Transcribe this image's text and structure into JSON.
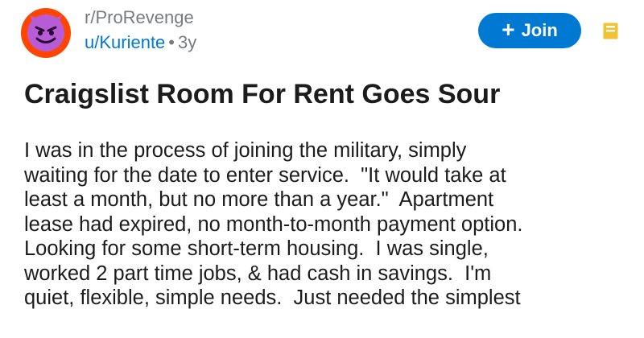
{
  "post": {
    "subreddit": "r/ProRevenge",
    "author": "u/Kuriente",
    "separator": "•",
    "age": "3y",
    "join_label": "Join",
    "join_icon": "+",
    "title": "Craigslist Room For Rent Goes Sour",
    "body_lines": [
      "I was in the process of joining the military, simply",
      "waiting for the date to enter service.  \"It would take at",
      "least a month, but no more than a year.\"  Apartment",
      "lease had expired, no month-to-month payment option.",
      "Looking for some short-term housing.  I was single,",
      "worked 2 part time jobs, & had cash in savings.  I'm",
      "quiet, flexible, simple needs.  Just needed the simplest"
    ]
  },
  "icons": {
    "avatar": "devil-face-icon",
    "join": "plus-icon",
    "save": "save-icon"
  },
  "colors": {
    "avatar_ring": "#ff4500",
    "avatar_face": "#b85cd6",
    "link_blue": "#0079d3",
    "meta_gray": "#787c7e",
    "save_yellow": "#f2c230"
  }
}
